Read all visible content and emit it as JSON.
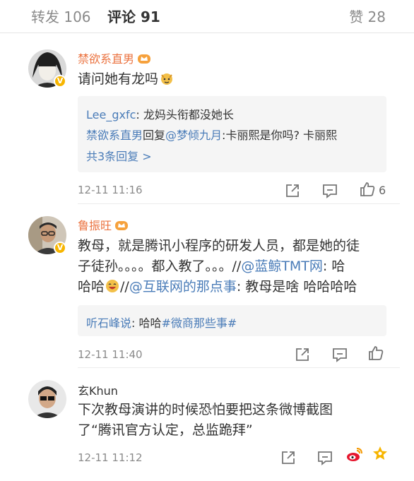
{
  "tabs": {
    "repost": "转发 106",
    "comment": "评论 91",
    "like": "赞 28"
  },
  "comments": [
    {
      "username": "禁欲系直男",
      "text": "请问她有龙吗",
      "replies": {
        "line1_user": "Lee_gxfc",
        "line1_text": ": 龙妈头衔都没她长",
        "line2_user": "禁欲系直男",
        "line2_mid": "回复",
        "line2_mention": "@梦倾九月",
        "line2_text": ":卡丽熙是你吗? 卡丽熙",
        "more": "共3条回复 >"
      },
      "time": "12-11 11:16",
      "likes": "6"
    },
    {
      "username": "鲁振旺",
      "line1": "教母，就是腾讯小程序的研发人员，都是她的徒",
      "line2_a": "子徒孙。。。。都入教了。。。//",
      "line2_link": "@蓝鲸TMT网",
      "line2_b": ": 哈",
      "line3_a": "哈哈",
      "line3_b": "//",
      "line3_link": "@互联网的那点事",
      "line3_c": ": 教母是啥 哈哈哈哈",
      "reply_user": "听石峰说",
      "reply_text": ": 哈哈",
      "reply_tag": "#微商那些事#",
      "time": "12-11 11:40"
    },
    {
      "username": "玄Khun",
      "line1": "下次教母演讲的时候恐怕要把这条微博截图",
      "line2": "了“腾讯官方认定，总监跪拜”",
      "time": "12-11 11:12"
    }
  ],
  "icons": [
    "share-icon",
    "reply-icon",
    "like-icon",
    "weibo-icon",
    "star-icon"
  ],
  "colors": {
    "username": "#eb7340",
    "link": "#4a7cb8",
    "tab_accent": "#f08232",
    "meta": "#8a8a8a"
  }
}
